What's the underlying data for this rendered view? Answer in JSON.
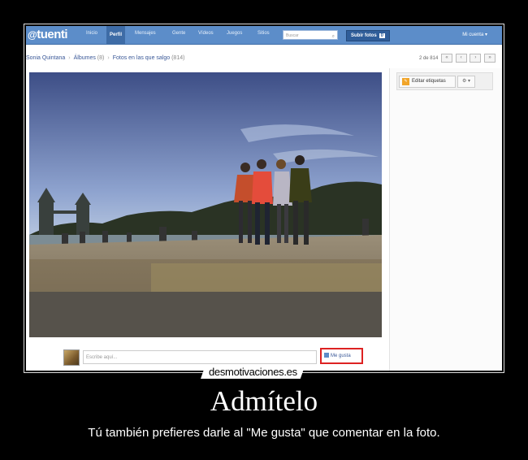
{
  "app": {
    "logo_prefix": "@",
    "logo_text": "tuenti"
  },
  "nav": {
    "items": [
      "Inicio",
      "Perfil",
      "Mensajes",
      "Gente",
      "Vídeos",
      "Juegos",
      "Sitios"
    ],
    "active_index": 1
  },
  "search": {
    "placeholder": "Buscar"
  },
  "upload": {
    "label": "Subir fotos",
    "count": "0"
  },
  "account": {
    "label": "Mi cuenta ▾"
  },
  "breadcrumb": {
    "user": "Sonia Quintana",
    "albums": "Álbumes",
    "albums_count": "(8)",
    "photos": "Fotos en las que salgo",
    "photos_count": "(814)"
  },
  "pager": {
    "position": "2 de 814"
  },
  "tags": {
    "edit_label": "Editar etiquetas",
    "gear_label": "⚙ ▾"
  },
  "comment": {
    "placeholder": "Escribe aquí...",
    "like_label": "Me gusta"
  },
  "caption": {
    "brand": "desmotivaciones.es",
    "title": "Admítelo",
    "subtitle": "Tú también prefieres darle al \"Me gusta\" que comentar en la foto."
  },
  "colors": {
    "nav_blue": "#5c8dc9",
    "highlight_red": "#dd2222",
    "tag_orange": "#f1a52a"
  }
}
